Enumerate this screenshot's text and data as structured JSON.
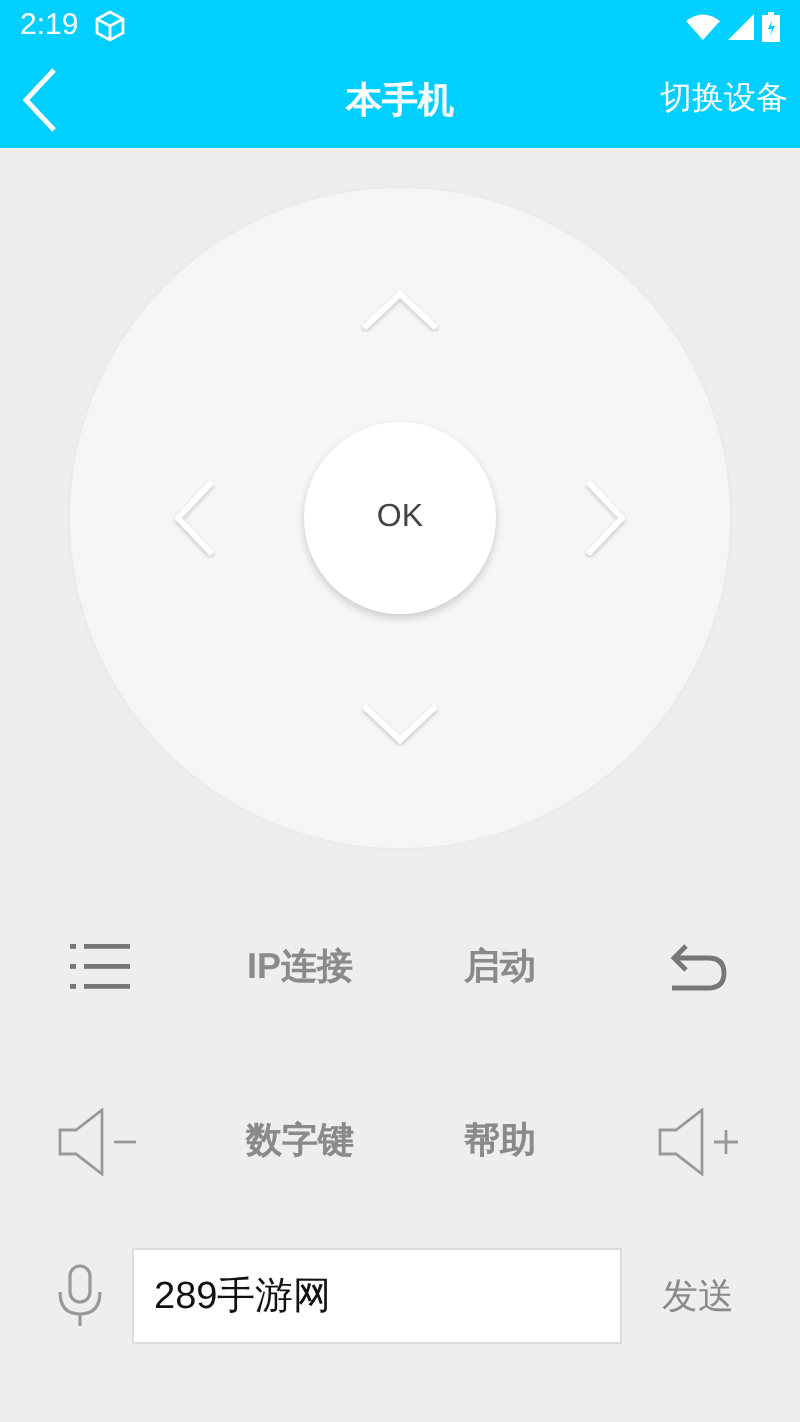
{
  "status_bar": {
    "time": "2:19"
  },
  "app_bar": {
    "title": "本手机",
    "action": "切换设备"
  },
  "dpad": {
    "ok": "OK"
  },
  "button_rows": [
    [
      {
        "kind": "menu"
      },
      {
        "kind": "text",
        "label": "IP连接"
      },
      {
        "kind": "text",
        "label": "启动"
      },
      {
        "kind": "undo"
      }
    ],
    [
      {
        "kind": "volume_down"
      },
      {
        "kind": "text",
        "label": "数字键"
      },
      {
        "kind": "text",
        "label": "帮助"
      },
      {
        "kind": "volume_up"
      }
    ]
  ],
  "input": {
    "value": "289手游网",
    "send": "发送"
  }
}
